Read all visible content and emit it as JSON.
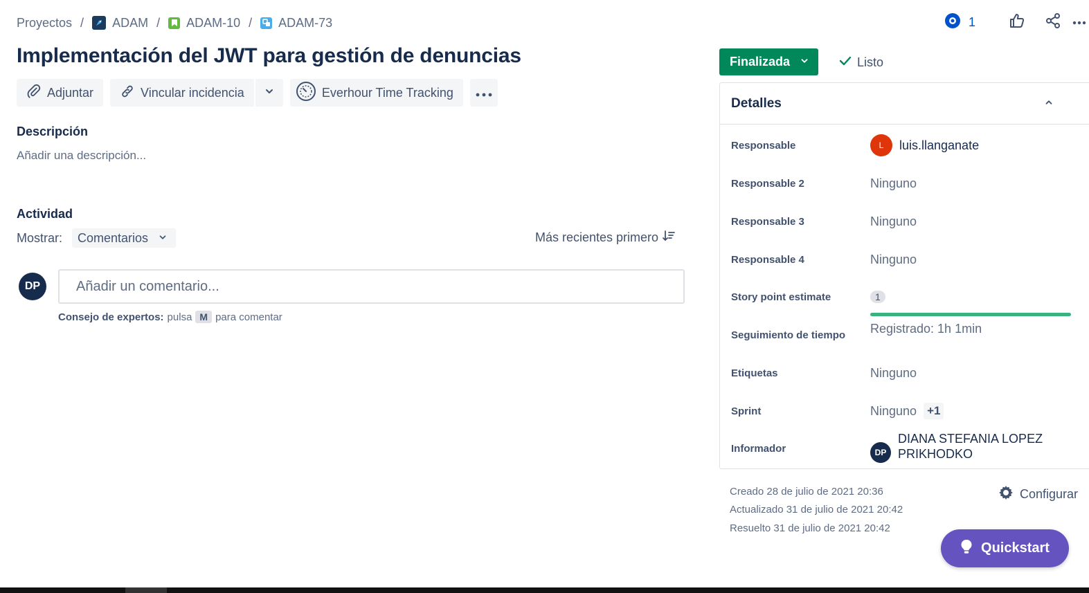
{
  "breadcrumb": {
    "items": [
      {
        "label": "Proyectos",
        "icon": ""
      },
      {
        "label": "ADAM",
        "icon": "rocket-project-icon"
      },
      {
        "label": "ADAM-10",
        "icon": "story-bookmark-icon"
      },
      {
        "label": "ADAM-73",
        "icon": "subtask-icon"
      }
    ],
    "separator": "/"
  },
  "header": {
    "watch_count": "1",
    "watch_icon": "eye-icon",
    "like_icon": "thumbs-up-icon",
    "share_icon": "share-icon",
    "more_icon": "more-horizontal-icon"
  },
  "issue": {
    "title": "Implementación del JWT para gestión de denuncias"
  },
  "toolbar": {
    "attach_label": "Adjuntar",
    "link_label": "Vincular incidencia",
    "everhour_label": "Everhour Time Tracking",
    "more_label": "•••"
  },
  "description": {
    "heading": "Descripción",
    "placeholder": "Añadir una descripción..."
  },
  "activity": {
    "heading": "Actividad",
    "show_label": "Mostrar:",
    "filter_value": "Comentarios",
    "sort_label": "Más recientes primero",
    "avatar_initials": "DP",
    "comment_placeholder": "Añadir un comentario...",
    "protip_bold": "Consejo de expertos:",
    "protip_press": "pulsa",
    "protip_key": "M",
    "protip_rest": "para comentar"
  },
  "status": {
    "label": "Finalizada",
    "color": "#00875a",
    "resolution": "Listo"
  },
  "details": {
    "heading": "Detalles",
    "fields": [
      {
        "label": "Responsable",
        "value": "luis.llanganate",
        "avatar": "L",
        "avatar_color": "#de350b"
      },
      {
        "label": "Responsable 2",
        "value": "Ninguno"
      },
      {
        "label": "Responsable 3",
        "value": "Ninguno"
      },
      {
        "label": "Responsable 4",
        "value": "Ninguno"
      },
      {
        "label": "Story point estimate",
        "value": "1"
      },
      {
        "label": "Seguimiento de tiempo",
        "value": "Registrado: 1h 1min",
        "progress": 1.0
      },
      {
        "label": "Etiquetas",
        "value": "Ninguno"
      },
      {
        "label": "Sprint",
        "value": "Ninguno",
        "extra": "+1"
      },
      {
        "label": "Informador",
        "value": "DIANA STEFANIA LOPEZ PRIKHODKO",
        "avatar": "DP",
        "avatar_color": "#172b4d"
      }
    ]
  },
  "meta": {
    "created": "Creado 28 de julio de 2021 20:36",
    "updated": "Actualizado 31 de julio de 2021 20:42",
    "resolved": "Resuelto 31 de julio de 2021 20:42",
    "configure_label": "Configurar"
  },
  "quickstart": {
    "label": "Quickstart",
    "color": "#6554c0"
  }
}
